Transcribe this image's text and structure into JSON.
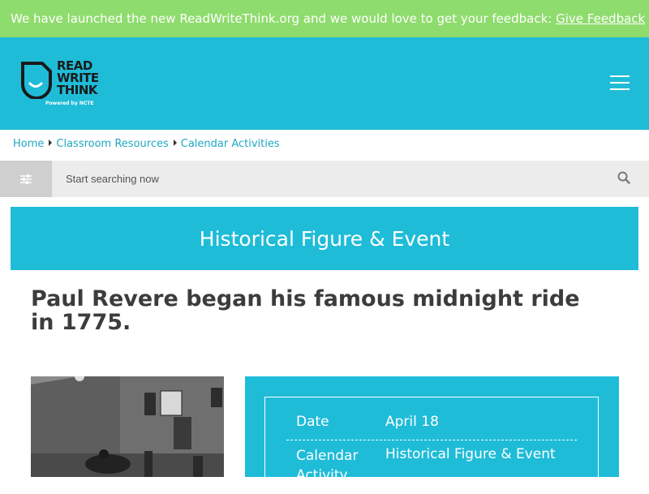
{
  "banner": {
    "message": "We have launched the new ReadWriteThink.org and we would love to get your feedback: ",
    "link_label": "Give Feedback"
  },
  "header": {
    "logo_lines": [
      "READ",
      "WRITE",
      "THINK"
    ],
    "logo_tagline": "Powered by NCTE",
    "menu_icon": "hamburger-menu-icon"
  },
  "breadcrumb": {
    "items": [
      "Home",
      "Classroom Resources",
      "Calendar Activities"
    ]
  },
  "search": {
    "placeholder": "Start searching now",
    "value": "",
    "filter_icon": "sliders-icon",
    "search_icon": "magnifier-icon"
  },
  "category": {
    "label": "Historical Figure & Event"
  },
  "main": {
    "title": "Paul Revere began his famous midnight ride in 1775."
  },
  "info": {
    "rows": [
      {
        "label": "Date",
        "value": "April 18"
      },
      {
        "label": "Calendar",
        "label_line2": "Activity",
        "value": "Historical Figure & Event"
      }
    ]
  },
  "colors": {
    "banner": "#8fdc6e",
    "brand": "#1fbcd8",
    "link": "#1fa9c2",
    "title": "#3c3c3c"
  }
}
